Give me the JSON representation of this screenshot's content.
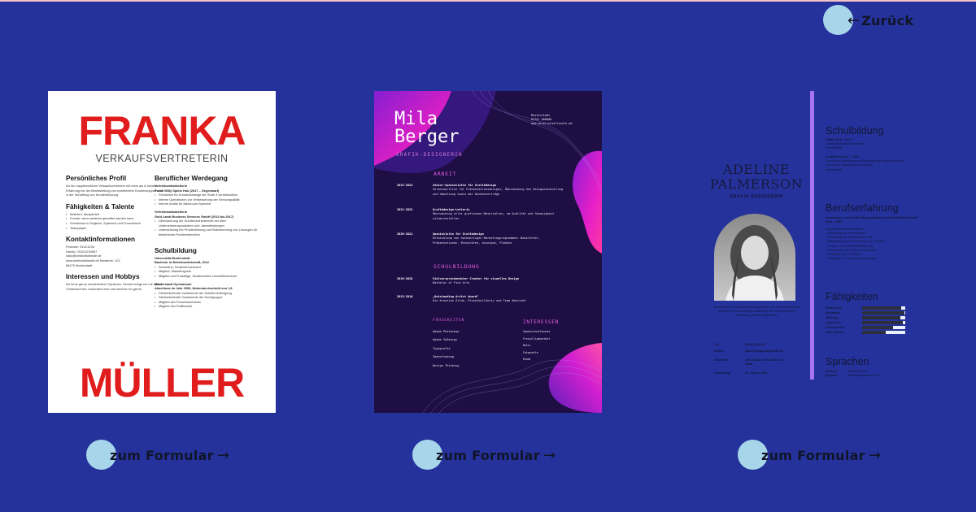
{
  "nav": {
    "back_label": "Zurück",
    "back_arrow": "←",
    "form_label": "zum Formular",
    "form_arrow": "→"
  },
  "colors": {
    "background": "#25329c",
    "button_circle": "#a7d6ea",
    "accent_red": "#e01c1c",
    "accent_purple": "#a873f0",
    "accent_pink": "#e55ee0"
  },
  "templates": [
    {
      "first_name": "FRANKA",
      "last_name": "MÜLLER",
      "role": "VERKAUFSVERTRETERIN",
      "profile_title": "Persönliches Profil",
      "profile_text": "Ich bin hauptberufliche Verkaufsvertreterin mit mehr als 6 Jahren Erfahrung bei der Bereitstellung von exzellentem Kundensupport und in der Schaffung von Kundenbindung.",
      "skills_title": "Fähigkeiten & Talente",
      "skills": [
        "Motiviert, diszipliniert",
        "Freude, wenn anderen geholfen werden kann",
        "Kenntnisse in Englisch, Spanisch und Französisch",
        "Teamplayer"
      ],
      "contact_title": "Kontaktinformationen",
      "contact_lines": [
        "Festnetz: 0111/1234",
        "Handy: 0151/1234567",
        "hallo@wirklichtollesite.de",
        "www.wirklichtollesite.de Musterstr. 123,",
        "68479 Musterstadt"
      ],
      "interests_title": "Interessen und Hobbys",
      "interests_text": "Ich lerne gerne verschiedene Sprachen. Derzeit bringe ich mir selbst Chinesisch bei. Außerdem lese und zeichne ich gerne.",
      "career_title": "Beruflicher Werdegang",
      "career": [
        {
          "role": "Vertriebsmitarbeiterin",
          "company": "Portal Willy Spielo Hub (2017 – Gegenwart)",
          "points": [
            "Persönlich für Kundenbelange der Stufe 3 verantwortlich",
            "Interne Operationen zur Verbesserung der Servicequalität",
            "Interne Audits für Backroom-Speicher"
          ]
        },
        {
          "role": "Vertriebsmitarbeiterin",
          "company": "Gold Lamb Business Services GmbH (2013 bis 2017)",
          "points": [
            "Überwachung der Kundenzufriedenheit bei allen Unternehmensprodukten und -dienstleistungen",
            "Unterstützung bei Problemlösung und Brainstorming von Lösungen für bestehende Problembereiche"
          ]
        }
      ],
      "education_title": "Schulbildung",
      "education": [
        {
          "school": "Universität Musterstadt",
          "degree": "Bachelor in Betriebswirtschaft, 2012",
          "points": [
            "Sekretärin, Studentenverband",
            "Mitglied, Marketingclub",
            "Mitglied und Freiwillige, Studierenden-Hochhilfezentrum"
          ]
        },
        {
          "school": "Musterstadt Gymnasium",
          "degree": "Abschluss im Jahr 2009, Notendurchschnitt von 1,8",
          "points": [
            "Stellvertretende Vorsitzende der Schülervereinigung",
            "Stellvertretende Vorsitzende der Kunstgruppe",
            "Mitglied des Französischclubs",
            "Mitglied des Politikclubs"
          ]
        }
      ]
    },
    {
      "first_name": "Mila",
      "last_name": "Berger",
      "role": "GRAFIK-DESIGNERIN",
      "contact_lines": [
        "Musterstadt",
        "0176/ 000000",
        "www.wirklichtollesite.de"
      ],
      "work_title": "ARBEIT",
      "work": [
        {
          "years": "2022-2023",
          "title": "Senior-Spezialistin für Grafikdesign",
          "text": "Verantwortlich für Präsentationsdesigns, Überwachung des Designentwicklung und Umsetzung sowie der Kundenverträge"
        },
        {
          "years": "2021-2022",
          "title": "Grafikdesign-Leiterin",
          "text": "Überwachung aller grafischen Materialien, um Qualität und Genauigkeit sicherzustellen"
        },
        {
          "years": "2020-2021",
          "title": "Spezialistin für Grafikdesign",
          "text": "Entwicklung von hochwertigen Marketingprogrammen: Newsletter, Präsentationen, Broschüren, Anzeigen, Plakate"
        }
      ],
      "edu_title": "SCHULBILDUNG",
      "edu": [
        {
          "years": "2016-2020",
          "title": "Vielversprechendster Creator für visuelles Design",
          "text": "Bachelor of Fine Arts"
        },
        {
          "years": "2013-2016",
          "title": "„Outstanding Artist Award“",
          "text": "Die Kreative Gilde, Pinselkollektiv und Team Abstrakt"
        }
      ],
      "abilities_title": "FÄHIGKEITEN",
      "abilities": [
        "Adobe Photoshop",
        "Adobe InDesign",
        "Typografie",
        "Ideenfindung",
        "Design Thinking"
      ],
      "interests_title": "INTERESSEN",
      "interests": [
        "Gemeinschaftskunst",
        "Freiwilligenarbeit",
        "Natur",
        "Fotografie",
        "Hunde"
      ]
    },
    {
      "name_line1": "ADELINE",
      "name_line2": "PALMERSON",
      "role": "GRAFIK-DESIGNERIN",
      "about": "Ich bin eine professionelle Werbegrafikerin, die einen Schwerpunkt im Bereich Druck und Web-Gestaltung und Branding besitzt. Einstellung, ideale Studentinnen.",
      "contact": [
        {
          "label": "Tel.:",
          "value": "(0123) 1234 56"
        },
        {
          "label": "E-Mail:",
          "value": "hallo@einegroseartseite.de"
        },
        {
          "label": "Anschrift:",
          "value": "Jede Straße 123 12345 Jede Stadt"
        },
        {
          "label": "Geburtstag:",
          "value": "01. Januar 2000"
        }
      ],
      "school_title": "Schulbildung",
      "school": [
        {
          "head": "Abitur 2015 – 2017",
          "lines": [
            "Landesgymnasium Bückeburg",
            "Musterstraße"
          ]
        },
        {
          "head": "Ausbildung 2017 – 2020",
          "lines": [
            "Schulische Ausbildung zum Medienassistent Digital und Print",
            "Hochschule Magdeburg und Stendal",
            "Musterstraße"
          ]
        }
      ],
      "career_title": "Berufserfahrung",
      "career": [
        {
          "head": "Anstellung in Vollzeit als Mediengestalterin bei Musterfirma GmbH 2020 – 2023",
          "lines": [
            "Aufgabenbereich beinhaltete:",
            "- Gestaltung von Print-Material",
            "- Gestaltung von Social-Media-Posts",
            "- Bildbearbeitung und Erstellung von Grafiken",
            "- Kunden- und Lieferantenbetreuung",
            "- Übersetzung von Texten ins Englische",
            "- Erstellung von Druckdaten",
            "- Erstellung der Produktbeschreibungen"
          ]
        }
      ],
      "skills_title": "Fähigkeiten",
      "skills": [
        {
          "name": "Photoshop",
          "level": 0.9
        },
        {
          "name": "Illustrator",
          "level": 0.98
        },
        {
          "name": "InDesign",
          "level": 0.88
        },
        {
          "name": "Lightroom",
          "level": 0.94
        },
        {
          "name": "Premiere Pro",
          "level": 0.72
        },
        {
          "name": "After Effects",
          "level": 0.55
        }
      ],
      "lang_title": "Sprachen",
      "languages": [
        {
          "lang": "Deutsch",
          "level": "Muttersprache"
        },
        {
          "lang": "Englisch",
          "level": "Muttersprachliches Level"
        }
      ]
    }
  ]
}
